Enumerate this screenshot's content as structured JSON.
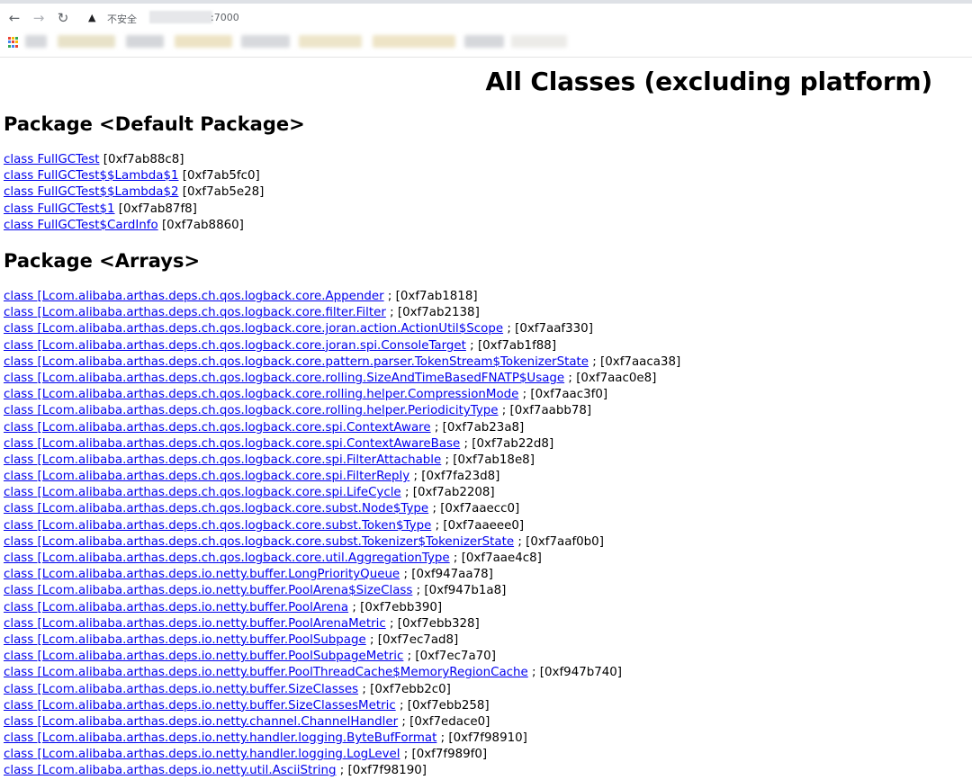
{
  "browser": {
    "back_icon": "arrow-left-icon",
    "forward_icon": "arrow-right-icon",
    "reload_icon": "reload-icon",
    "security_icon": "warning-triangle-icon",
    "security_label": "不安全",
    "url_port": ":7000"
  },
  "page": {
    "title": "All Classes (excluding platform)",
    "packages": [
      {
        "heading": "Package <Default Package>",
        "classes": [
          {
            "link": "class FullGCTest",
            "address": "[0xf7ab88c8]"
          },
          {
            "link": "class FullGCTest$$Lambda$1",
            "address": "[0xf7ab5fc0]"
          },
          {
            "link": "class FullGCTest$$Lambda$2",
            "address": "[0xf7ab5e28]"
          },
          {
            "link": "class FullGCTest$1",
            "address": "[0xf7ab87f8]"
          },
          {
            "link": "class FullGCTest$CardInfo",
            "address": "[0xf7ab8860]"
          }
        ]
      },
      {
        "heading": "Package <Arrays>",
        "classes": [
          {
            "link": "class [Lcom.alibaba.arthas.deps.ch.qos.logback.core.Appender",
            "address": "; [0xf7ab1818]"
          },
          {
            "link": "class [Lcom.alibaba.arthas.deps.ch.qos.logback.core.filter.Filter",
            "address": "; [0xf7ab2138]"
          },
          {
            "link": "class [Lcom.alibaba.arthas.deps.ch.qos.logback.core.joran.action.ActionUtil$Scope",
            "address": "; [0xf7aaf330]"
          },
          {
            "link": "class [Lcom.alibaba.arthas.deps.ch.qos.logback.core.joran.spi.ConsoleTarget",
            "address": "; [0xf7ab1f88]"
          },
          {
            "link": "class [Lcom.alibaba.arthas.deps.ch.qos.logback.core.pattern.parser.TokenStream$TokenizerState",
            "address": "; [0xf7aaca38]"
          },
          {
            "link": "class [Lcom.alibaba.arthas.deps.ch.qos.logback.core.rolling.SizeAndTimeBasedFNATP$Usage",
            "address": "; [0xf7aac0e8]"
          },
          {
            "link": "class [Lcom.alibaba.arthas.deps.ch.qos.logback.core.rolling.helper.CompressionMode",
            "address": "; [0xf7aac3f0]"
          },
          {
            "link": "class [Lcom.alibaba.arthas.deps.ch.qos.logback.core.rolling.helper.PeriodicityType",
            "address": "; [0xf7aabb78]"
          },
          {
            "link": "class [Lcom.alibaba.arthas.deps.ch.qos.logback.core.spi.ContextAware",
            "address": "; [0xf7ab23a8]"
          },
          {
            "link": "class [Lcom.alibaba.arthas.deps.ch.qos.logback.core.spi.ContextAwareBase",
            "address": "; [0xf7ab22d8]"
          },
          {
            "link": "class [Lcom.alibaba.arthas.deps.ch.qos.logback.core.spi.FilterAttachable",
            "address": "; [0xf7ab18e8]"
          },
          {
            "link": "class [Lcom.alibaba.arthas.deps.ch.qos.logback.core.spi.FilterReply",
            "address": "; [0xf7fa23d8]"
          },
          {
            "link": "class [Lcom.alibaba.arthas.deps.ch.qos.logback.core.spi.LifeCycle",
            "address": "; [0xf7ab2208]"
          },
          {
            "link": "class [Lcom.alibaba.arthas.deps.ch.qos.logback.core.subst.Node$Type",
            "address": "; [0xf7aaecc0]"
          },
          {
            "link": "class [Lcom.alibaba.arthas.deps.ch.qos.logback.core.subst.Token$Type",
            "address": "; [0xf7aaeee0]"
          },
          {
            "link": "class [Lcom.alibaba.arthas.deps.ch.qos.logback.core.subst.Tokenizer$TokenizerState",
            "address": "; [0xf7aaf0b0]"
          },
          {
            "link": "class [Lcom.alibaba.arthas.deps.ch.qos.logback.core.util.AggregationType",
            "address": "; [0xf7aae4c8]"
          },
          {
            "link": "class [Lcom.alibaba.arthas.deps.io.netty.buffer.LongPriorityQueue",
            "address": "; [0xf947aa78]"
          },
          {
            "link": "class [Lcom.alibaba.arthas.deps.io.netty.buffer.PoolArena$SizeClass",
            "address": "; [0xf947b1a8]"
          },
          {
            "link": "class [Lcom.alibaba.arthas.deps.io.netty.buffer.PoolArena",
            "address": "; [0xf7ebb390]"
          },
          {
            "link": "class [Lcom.alibaba.arthas.deps.io.netty.buffer.PoolArenaMetric",
            "address": "; [0xf7ebb328]"
          },
          {
            "link": "class [Lcom.alibaba.arthas.deps.io.netty.buffer.PoolSubpage",
            "address": "; [0xf7ec7ad8]"
          },
          {
            "link": "class [Lcom.alibaba.arthas.deps.io.netty.buffer.PoolSubpageMetric",
            "address": "; [0xf7ec7a70]"
          },
          {
            "link": "class [Lcom.alibaba.arthas.deps.io.netty.buffer.PoolThreadCache$MemoryRegionCache",
            "address": "; [0xf947b740]"
          },
          {
            "link": "class [Lcom.alibaba.arthas.deps.io.netty.buffer.SizeClasses",
            "address": "; [0xf7ebb2c0]"
          },
          {
            "link": "class [Lcom.alibaba.arthas.deps.io.netty.buffer.SizeClassesMetric",
            "address": "; [0xf7ebb258]"
          },
          {
            "link": "class [Lcom.alibaba.arthas.deps.io.netty.channel.ChannelHandler",
            "address": "; [0xf7edace0]"
          },
          {
            "link": "class [Lcom.alibaba.arthas.deps.io.netty.handler.logging.ByteBufFormat",
            "address": "; [0xf7f98910]"
          },
          {
            "link": "class [Lcom.alibaba.arthas.deps.io.netty.handler.logging.LogLevel",
            "address": "; [0xf7f989f0]"
          },
          {
            "link": "class [Lcom.alibaba.arthas.deps.io.netty.util.AsciiString",
            "address": "; [0xf7f98190]"
          }
        ]
      }
    ]
  }
}
